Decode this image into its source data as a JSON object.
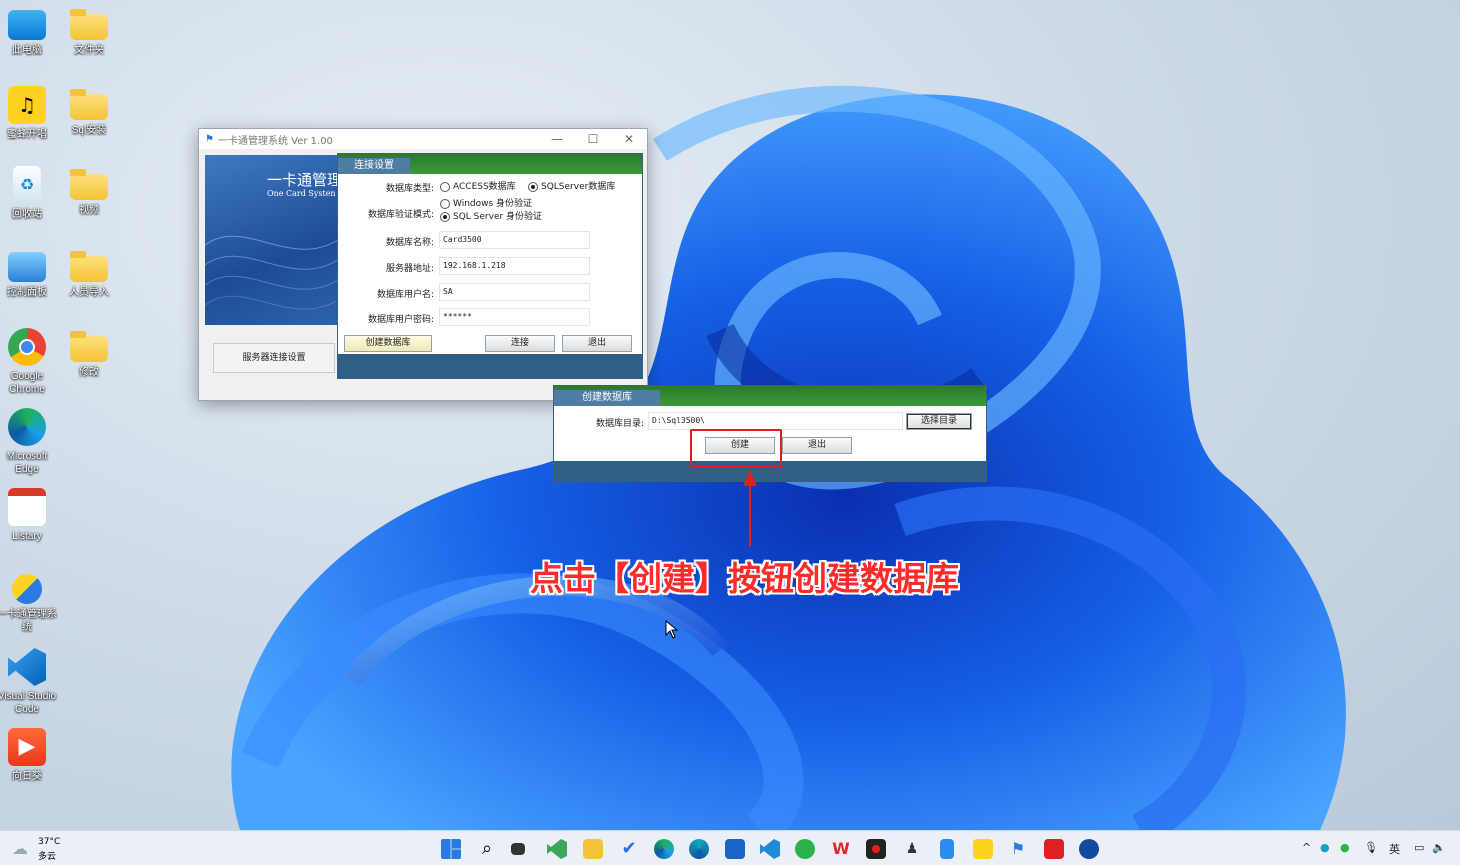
{
  "desktop": {
    "icons": [
      {
        "label": "此电脑",
        "icon": "computer-icon"
      },
      {
        "label": "文件夹",
        "icon": "folder-icon"
      },
      {
        "label": "蜜蜂开唱",
        "icon": "app-icon"
      },
      {
        "label": "Sql安装",
        "icon": "folder-icon"
      },
      {
        "label": "回收站",
        "icon": "recycle-bin-icon"
      },
      {
        "label": "视频",
        "icon": "folder-icon"
      },
      {
        "label": "控制面板",
        "icon": "control-panel-icon"
      },
      {
        "label": "人员导入",
        "icon": "folder-icon"
      },
      {
        "label": "Google Chrome",
        "icon": "chrome-icon"
      },
      {
        "label": "修改",
        "icon": "folder-icon"
      },
      {
        "label": "Microsoft Edge",
        "icon": "edge-icon"
      },
      {
        "label": "Listary",
        "icon": "listary-icon"
      },
      {
        "label": "一卡通管理系统",
        "icon": "onecard-icon"
      },
      {
        "label": "Visual Studio Code",
        "icon": "vscode-icon"
      },
      {
        "label": "向日葵",
        "icon": "sunlogin-icon"
      }
    ]
  },
  "main_window": {
    "title": "一卡通管理系统  Ver 1.00",
    "banner_title": "一卡通管理",
    "banner_subtitle": "One Card Systen",
    "server_button": "服务器连接设置"
  },
  "connect_dialog": {
    "tab": "连接设置",
    "db_type_label": "数据库类型:",
    "db_type_options": [
      "ACCESS数据库",
      "SQLServer数据库"
    ],
    "db_type_selected": "SQLServer数据库",
    "auth_label": "数据库验证模式:",
    "auth_options": [
      "Windows 身份验证",
      "SQL Server 身份验证"
    ],
    "auth_selected": "SQL Server 身份验证",
    "name_label": "数据库名称:",
    "name_value": "Card3500",
    "server_label": "服务器地址:",
    "server_value": "192.168.1.218",
    "user_label": "数据库用户名:",
    "user_value": "SA",
    "pwd_label": "数据库用户密码:",
    "pwd_value": "******",
    "create_db_button": "创建数据库",
    "connect_button": "连接",
    "exit_button": "退出"
  },
  "create_dialog": {
    "tab": "创建数据库",
    "dir_label": "数据库目录:",
    "dir_value": "D:\\Sql3500\\",
    "choose_button": "选择目录",
    "create_button": "创建",
    "exit_button": "退出"
  },
  "annotation": {
    "text": "点击【创建】按钮创建数据库",
    "highlight_color": "#e02020"
  },
  "taskbar": {
    "weather_temp": "37°C",
    "weather_desc": "多云",
    "ime": "英",
    "apps": [
      "start-icon",
      "search-icon",
      "task-view-icon",
      "visual-studio-icon",
      "file-explorer-icon",
      "todo-icon",
      "edge-icon",
      "edge-dev-icon",
      "store-icon",
      "vscode-icon",
      "wechat-icon",
      "wps-icon",
      "recorder-icon",
      "person-icon",
      "phone-icon",
      "beehive-icon",
      "flag-icon",
      "fudu-icon",
      "network-icon"
    ]
  }
}
